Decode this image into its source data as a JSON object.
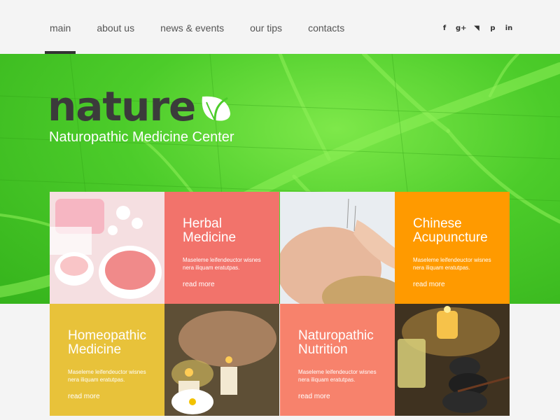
{
  "nav": {
    "items": [
      {
        "label": "main",
        "active": true
      },
      {
        "label": "about us",
        "active": false
      },
      {
        "label": "news & events",
        "active": false
      },
      {
        "label": "our tips",
        "active": false
      },
      {
        "label": "contacts",
        "active": false
      }
    ]
  },
  "social": [
    {
      "icon": "facebook-icon",
      "glyph": "f"
    },
    {
      "icon": "google-plus-icon",
      "glyph": "g+"
    },
    {
      "icon": "rss-icon",
      "glyph": "◥"
    },
    {
      "icon": "pinterest-icon",
      "glyph": "p"
    },
    {
      "icon": "linkedin-icon",
      "glyph": "in"
    }
  ],
  "hero": {
    "logo_text": "nature",
    "tagline": "Naturopathic Medicine Center"
  },
  "tiles": {
    "herbal": {
      "title": "Herbal Medicine",
      "desc": "Maseleme leifendeuctor wisnes nera iliquam eratutpas.",
      "more": "read more",
      "color": "#f2736b"
    },
    "acupuncture": {
      "title": "Chinese Acupuncture",
      "desc": "Maseleme leifendeuctor wisnes nera iliquam eratutpas.",
      "more": "read more",
      "color": "#ff9a00"
    },
    "homeopathic": {
      "title": "Homeopathic Medicine",
      "desc": "Maseleme leifendeuctor wisnes nera iliquam eratutpas.",
      "more": "read more",
      "color": "#e8c23a"
    },
    "nutrition": {
      "title": "Naturopathic Nutrition",
      "desc": "Maseleme leifendeuctor wisnes nera iliquam eratutpas.",
      "more": "read more",
      "color": "#f7826c"
    }
  },
  "colors": {
    "leaf_green": "#4ccc2a",
    "nav_text": "#555555",
    "logo_dark": "#3b3b3b"
  }
}
